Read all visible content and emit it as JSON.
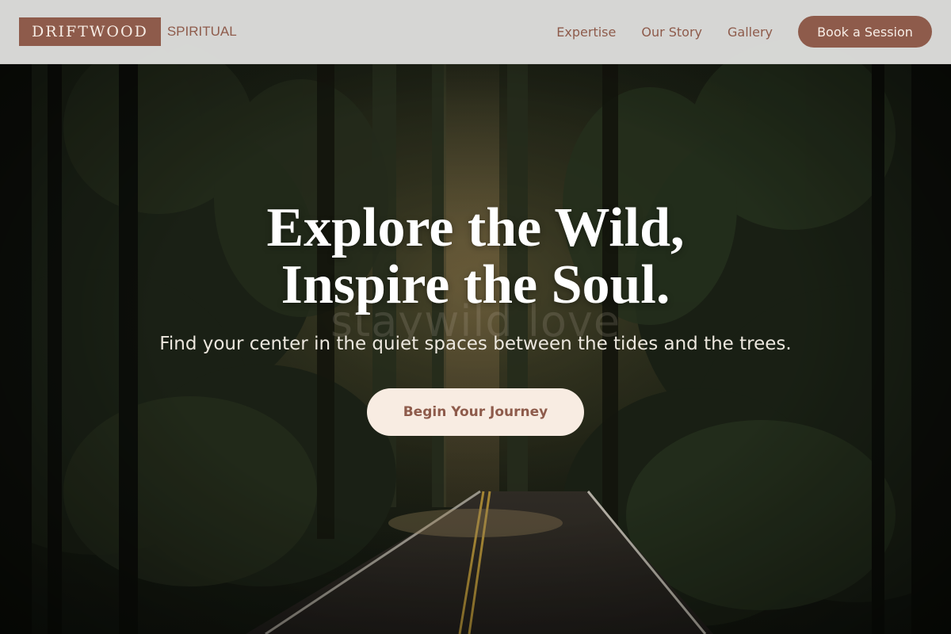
{
  "header": {
    "logo_main": "DRIFTWOOD",
    "logo_sub": "SPIRITUAL",
    "nav": [
      {
        "label": "Expertise"
      },
      {
        "label": "Our Story"
      },
      {
        "label": "Gallery"
      }
    ],
    "cta_label": "Book a Session"
  },
  "hero": {
    "headline_line1": "Explore the Wild,",
    "headline_line2": "Inspire the Soul.",
    "watermark": "staywild love",
    "subline": "Find your center in the quiet spaces between the tides and the trees.",
    "cta_label": "Begin Your Journey",
    "background": "forest-road-photo"
  },
  "colors": {
    "brand": "#8e5b4b",
    "cta_light": "#f8ece2",
    "header_bg": "#dddddb"
  }
}
